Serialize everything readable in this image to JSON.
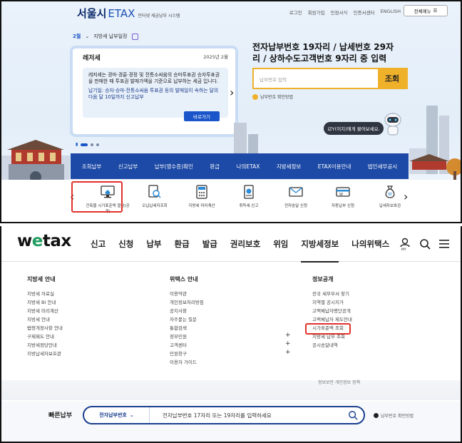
{
  "etax": {
    "brand_main": "서울시",
    "brand_etax": "ETAX",
    "brand_sub": "인터넷 세금납부 시스템",
    "toplinks": [
      "로그인",
      "회원가입",
      "민원서식",
      "인증서센터",
      "ENGLISH"
    ],
    "allmenu_label": "전체메뉴",
    "month_label": "2월",
    "schedule_label": "지방세 납부일정",
    "card": {
      "title": "레저세",
      "date": "2025년 2월",
      "desc": "레저세는 경마·경륜·경정 및 전통소싸움의 승마투표권 승자투표권을 판매한 때 투표권 발매가액을 기준으로 납부하는 세금 입니다.",
      "deadline_label": "납기일:",
      "deadline_text": "승자·승마·전통소싸움 투표권 등의 발매일이 속하는 달의 다음 달 10일까지 신고납부",
      "button": "바로가기"
    },
    "right_title": "전자납부번호 19자리 / 납세번호 29자리 / 상하수도고객번호 9자리 중 입력",
    "search_placeholder": "납부번호 입력",
    "search_button": "조회",
    "hint": "납부번호 확인방법",
    "izy_bubble": "IZY(이지)에게 물어보세요.",
    "nav": [
      "조회납부",
      "신고납부",
      "납부(영수증)확인",
      "환급",
      "나의ETAX",
      "지방세정보",
      "ETAX이용안내",
      "법인세무공시"
    ],
    "quick": [
      {
        "label": "건축물 시가표준액 열람(공개)",
        "icon": "monitor-house-icon"
      },
      {
        "label": "오납납세자조회",
        "icon": "search-doc-icon"
      },
      {
        "label": "지방세 미리계산",
        "icon": "calculator-icon"
      },
      {
        "label": "취득세 신고",
        "icon": "receipt-icon"
      },
      {
        "label": "전자송달 신청",
        "icon": "mail-icon"
      },
      {
        "label": "자동납부 신청",
        "icon": "card-icon"
      },
      {
        "label": "납세자보호관",
        "icon": "moneybag-icon"
      }
    ]
  },
  "wetax": {
    "logo_w": "w",
    "logo_e": "e",
    "logo_rest": "tax",
    "gnb": [
      "신고",
      "신청",
      "납부",
      "환급",
      "발급",
      "권리보호",
      "위임",
      "지방세정보",
      "나의위택스"
    ],
    "my_label": "MY",
    "columns": [
      {
        "title": "지방세 안내",
        "items": [
          "지방세 자료실",
          "지방세 BI 안내",
          "지방세 미리계산",
          "지방세 안내",
          "법령개정사항 안내",
          "구제제도 안내",
          "지방세정당안내",
          "지방납세자보호관"
        ]
      },
      {
        "title": "위택스 안내",
        "items": [
          "이용약관",
          "개인정보처리방침",
          "공지사항",
          "자주묻는 질문",
          "통합검색",
          "정부민원",
          "고객센터",
          "민원창구",
          "이용자 가이드"
        ]
      },
      {
        "title": "정보공개",
        "items": [
          "전국 세무부서 찾기",
          "지역별 공시지가",
          "고액체납자명단공개",
          "고액체납자 제도안내",
          "시가표준액 조회",
          "지방세 납부 조회",
          "공시송달내역"
        ]
      }
    ],
    "bg_text": "정보보안 개인정보 정책",
    "quickpay_label": "빠른납부",
    "quickpay_select": "전자납부번호",
    "quickpay_input": "전자납부번호 17자리 또는 19자리를 입력하세요",
    "quickpay_hint": "납부번호 확인방법"
  },
  "colors": {
    "etax_nav": "#1d4aa6",
    "etax_accent": "#f0b12a",
    "highlight": "#e0312b",
    "wetax_green": "#1f9c61",
    "wetax_navy": "#1b3f8f"
  }
}
